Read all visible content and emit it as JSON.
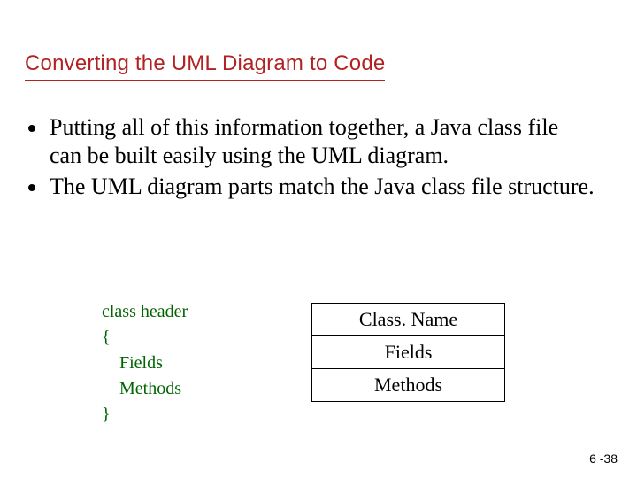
{
  "title": "Converting the UML Diagram to Code",
  "bullets": [
    "Putting all of this information together, a Java class file can be built easily using the UML diagram.",
    "The UML diagram parts match the Java class file structure."
  ],
  "code": {
    "line1": "class header",
    "line2": "{",
    "line3": "Fields",
    "line4": "Methods",
    "line5": "}"
  },
  "uml": {
    "row1": "Class. Name",
    "row2": "Fields",
    "row3": "Methods"
  },
  "footer": "6 -38"
}
